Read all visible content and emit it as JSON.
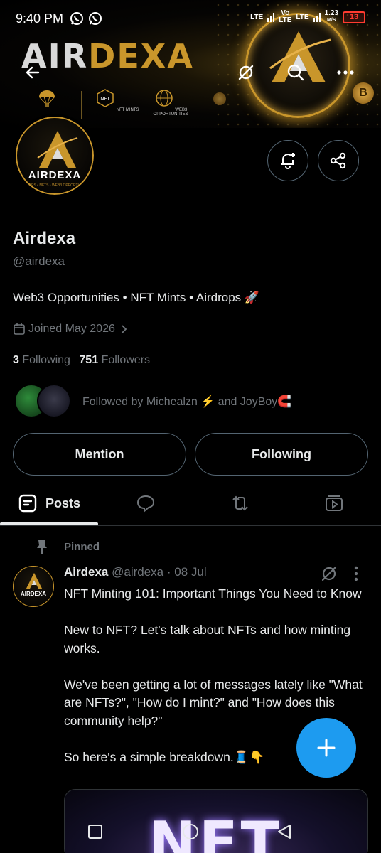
{
  "status_bar": {
    "time": "9:40 PM",
    "net1": "LTE",
    "net2_top": "Vo",
    "net2_bottom": "LTE",
    "net3": "LTE",
    "speed_value": "1.23",
    "speed_unit": "M/S",
    "battery": "13"
  },
  "banner": {
    "logo_part1": "AIR",
    "logo_part2": "DEXA",
    "badges": [
      "",
      "NFT MINTS",
      "WEB3 OPPORTUNITIES"
    ],
    "coin_label": "B"
  },
  "avatar": {
    "logo_text": "AIRDEXA",
    "sub_text": "AIRDROPS • NFTS • WEB3 OPPORTUNITIES"
  },
  "profile": {
    "name": "Airdexa",
    "handle": "@airdexa",
    "bio": "Web3 Opportunities • NFT Mints • Airdrops 🚀",
    "joined": "Joined May 2026",
    "following_count": "3",
    "following_label": "Following",
    "followers_count": "751",
    "followers_label": "Followers",
    "followed_by": "Followed by Michealzn ⚡ and JoyBoy🧲"
  },
  "actions": {
    "mention": "Mention",
    "following": "Following"
  },
  "tabs": {
    "posts": "Posts"
  },
  "tweet": {
    "pinned": "Pinned",
    "name": "Airdexa",
    "handle": "@airdexa",
    "separator": "·",
    "date": "08 Jul",
    "avatar_text": "AIRDEXA",
    "paragraphs": [
      "NFT Minting 101: Important Things You Need to Know",
      "New to NFT? Let's talk about NFTs and how minting works.",
      "We've been getting a lot of messages lately like \"What are NFTs?\", \"How do I mint?\" and \"How does this community help?\"",
      "So here's a simple breakdown.🧵👇"
    ],
    "media_text": "NFT"
  },
  "colors": {
    "accent": "#1d9bf0",
    "gold": "#c9962b",
    "muted": "#71767b",
    "border": "#536471",
    "battery": "#ff3b30"
  }
}
